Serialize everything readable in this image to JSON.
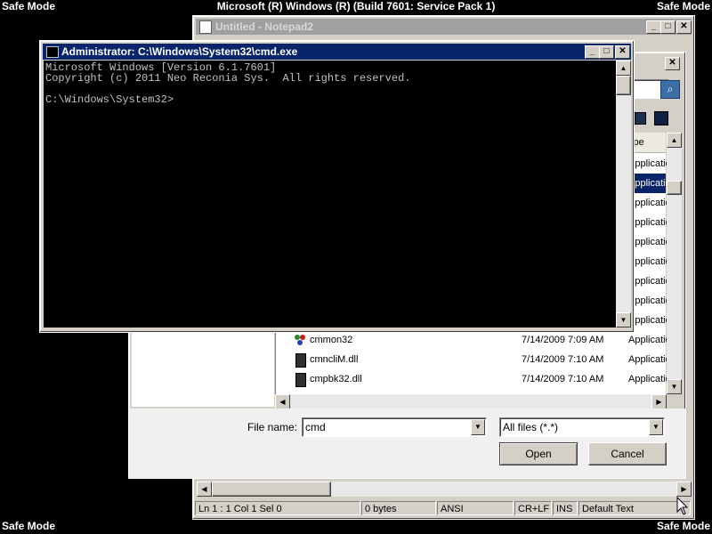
{
  "screen": {
    "safe_mode_label": "Safe Mode",
    "os_title": "Microsoft (R) Windows (R) (Build 7601: Service Pack 1)"
  },
  "notepad": {
    "title": "Untitled - Notepad2",
    "status": {
      "position": "Ln 1 : 1   Col 1   Sel 0",
      "size": "0 bytes",
      "encoding": "ANSI",
      "line_endings": "CR+LF",
      "mode": "INS",
      "scheme": "Default Text"
    }
  },
  "open_dialog": {
    "type_header": "ype",
    "type_rows": [
      "Applicatio",
      "Applicatio",
      "Applicatio",
      "Applicatio",
      "Applicatio",
      "Applicatio",
      "Applicatio",
      "Applicatio",
      "Applicatio"
    ],
    "files": [
      {
        "name": "cmmon32",
        "date": "7/14/2009 7:09 AM",
        "type": "Applicatio"
      },
      {
        "name": "cmncliM.dll",
        "date": "7/14/2009 7:10 AM",
        "type": "Applicatio"
      },
      {
        "name": "cmpbk32.dll",
        "date": "7/14/2009 7:10 AM",
        "type": "Applicatio"
      }
    ],
    "file_name_label": "File name:",
    "file_name_value": "cmd",
    "filter_value": "All files (*.*)",
    "open_label": "Open",
    "cancel_label": "Cancel"
  },
  "cmd": {
    "title": "Administrator: C:\\Windows\\System32\\cmd.exe",
    "lines": [
      "Microsoft Windows [Version 6.1.7601]",
      "Copyright (c) 2011 Neo Reconia Sys.  All rights reserved.",
      "",
      "C:\\Windows\\System32>"
    ]
  },
  "colors": {
    "desktop": "#000000",
    "cmd_title": "#0a246a",
    "selected_row": "#0a246a",
    "inactive_title": "#a0a0a0"
  }
}
